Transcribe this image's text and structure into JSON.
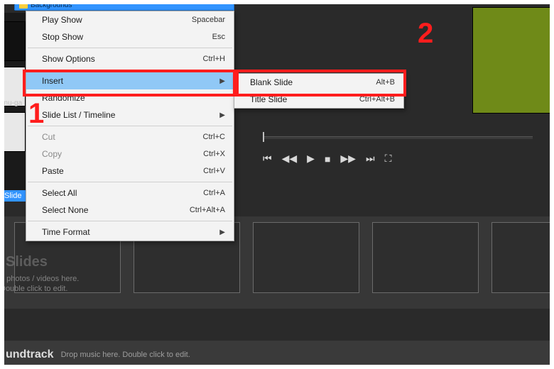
{
  "topbar": {
    "folder_label": "Backgrounds"
  },
  "left": {
    "menu_ga_label": "enu-ga",
    "slide_chip": "Slide"
  },
  "menu": {
    "items": [
      {
        "label": "Play Show",
        "kbd": "Spacebar"
      },
      {
        "label": "Stop Show",
        "kbd": "Esc"
      },
      {
        "label": "Show Options",
        "kbd": "Ctrl+H"
      },
      {
        "label": "Insert",
        "submenu": true
      },
      {
        "label": "Randomize"
      },
      {
        "label": "Slide List / Timeline",
        "submenu": true
      },
      {
        "label": "Cut",
        "kbd": "Ctrl+C",
        "disabled": true
      },
      {
        "label": "Copy",
        "kbd": "Ctrl+X",
        "disabled": true
      },
      {
        "label": "Paste",
        "kbd": "Ctrl+V"
      },
      {
        "label": "Select All",
        "kbd": "Ctrl+A"
      },
      {
        "label": "Select None",
        "kbd": "Ctrl+Alt+A"
      },
      {
        "label": "Time Format",
        "submenu": true
      }
    ]
  },
  "submenu": {
    "items": [
      {
        "label": "Blank Slide",
        "kbd": "Alt+B"
      },
      {
        "label": "Title Slide",
        "kbd": "Ctrl+Alt+B"
      }
    ]
  },
  "transport": {
    "icons": [
      "skip-start",
      "rewind",
      "play",
      "stop",
      "forward",
      "skip-end",
      "fullscreen"
    ],
    "glyphs": [
      "⏮",
      "◀◀",
      "▶",
      "■",
      "▶▶",
      "⏭",
      "⛶"
    ]
  },
  "placeholders": {
    "section_title": "Slides",
    "hint_line1": "p photos / videos here.",
    "hint_line2": "Double click to edit."
  },
  "soundtrack": {
    "title": "undtrack",
    "hint": "Drop music here.  Double click to edit."
  },
  "annotations": {
    "one": "1",
    "two": "2"
  }
}
